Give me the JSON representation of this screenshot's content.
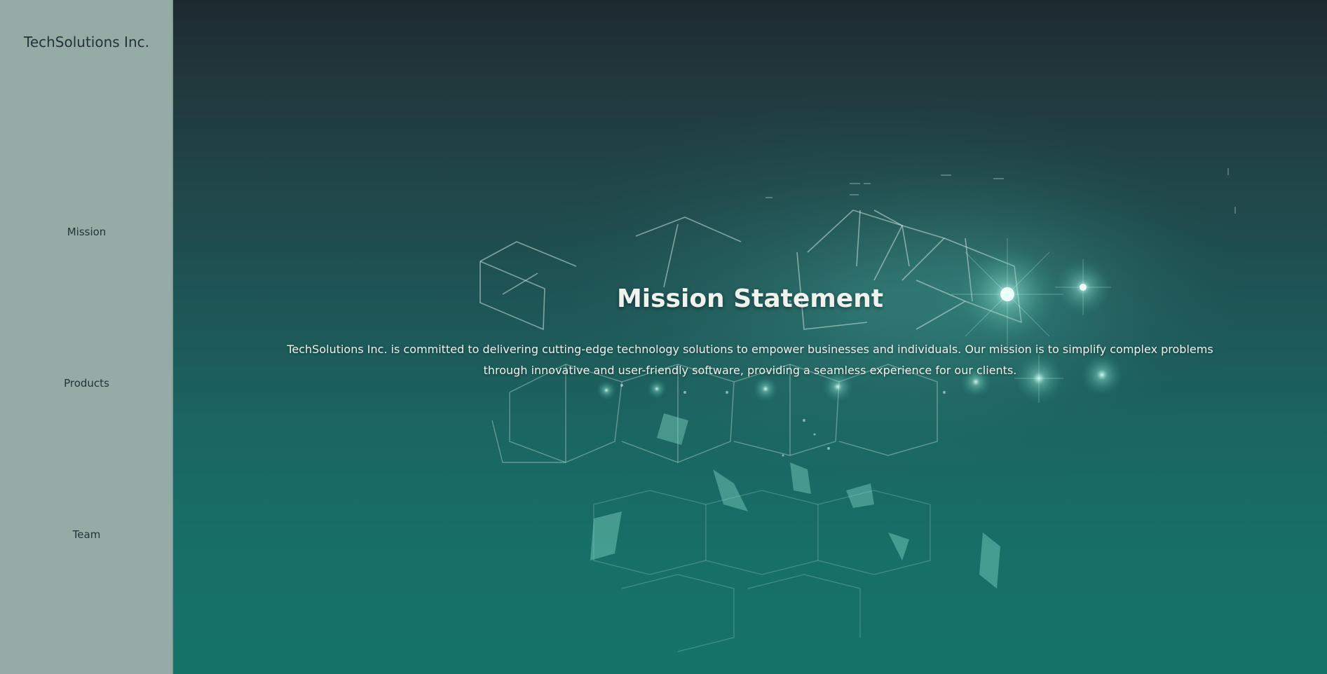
{
  "sidebar": {
    "brand": "TechSolutions Inc.",
    "items": [
      {
        "label": "Mission"
      },
      {
        "label": "Products"
      },
      {
        "label": "Team"
      }
    ]
  },
  "main": {
    "title": "Mission Statement",
    "body": "TechSolutions Inc. is committed to delivering cutting-edge technology solutions to empower businesses and individuals. Our mission is to simplify complex problems through innovative and user-friendly software, providing a seamless experience for our clients.",
    "background": "shattering-wireframe-cubes-image"
  },
  "colors": {
    "sidebar_bg": "#94aca5",
    "sidebar_text": "#24333a",
    "main_top": "#1e2a30",
    "main_bottom": "#157468",
    "text_light": "#eef3ef"
  }
}
